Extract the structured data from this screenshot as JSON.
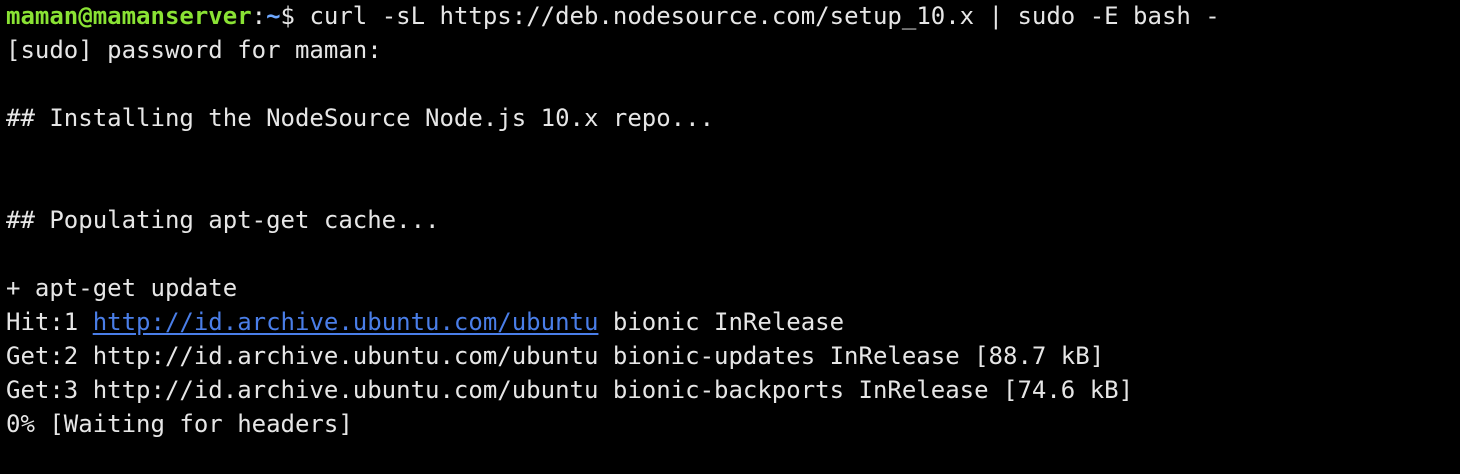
{
  "colors": {
    "background": "#000000",
    "text": "#e6e6e6",
    "prompt_user": "#8ae234",
    "prompt_path": "#6fa8ff",
    "link": "#4a7ee8"
  },
  "prompt": {
    "user_host": "maman@mamanserver",
    "colon": ":",
    "path": "~",
    "dollar": "$",
    "command": " curl -sL https://deb.nodesource.com/setup_10.x | sudo -E bash -"
  },
  "lines": {
    "sudo_password": "[sudo] password for maman:",
    "installing": "## Installing the NodeSource Node.js 10.x repo...",
    "populating": "## Populating apt-get cache...",
    "apt_update": "+ apt-get update",
    "hit1_prefix": "Hit:1 ",
    "hit1_url": "http://id.archive.ubuntu.com/ubuntu",
    "hit1_suffix": " bionic InRelease",
    "get2": "Get:2 http://id.archive.ubuntu.com/ubuntu bionic-updates InRelease [88.7 kB]",
    "get3": "Get:3 http://id.archive.ubuntu.com/ubuntu bionic-backports InRelease [74.6 kB]",
    "progress": "0% [Waiting for headers]"
  }
}
